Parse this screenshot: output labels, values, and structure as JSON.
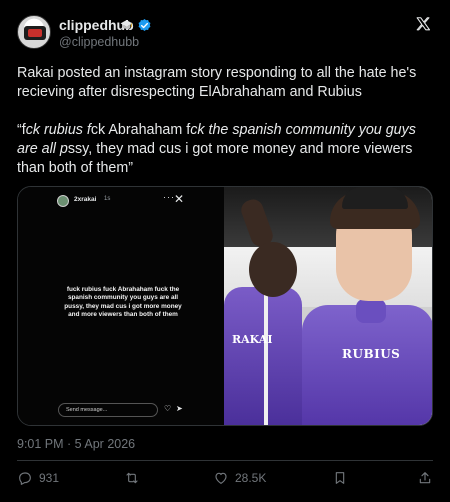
{
  "author": {
    "display_name": "clippedhub",
    "handle": "@clippedhubb",
    "avatar_icon": "avatar-logo",
    "badge_icons": [
      "graduation-cap-icon",
      "verified-badge-icon"
    ],
    "verified_color": "#1d9bf0"
  },
  "tweet": {
    "line1": "Rakai posted an instagram story responding to all the hate he's recieving after disrespecting ElAbrahaham and Rubius",
    "quote_open": "“f",
    "quote_a": "ck rubius f",
    "quote_b": "ck Abrahaham f",
    "quote_c_it": "ck the spanish community you guys are all p",
    "quote_d": "ssy, they mad cus i got more money and more viewers than both of them”"
  },
  "media": {
    "story": {
      "username": "2xrakai",
      "time": "1s",
      "caption": "fuck rubius fuck Abrahaham fuck the spanish community you guys are all pussy, they mad cus i got more money and more viewers than both of them",
      "message_placeholder": "Send message..."
    },
    "photo": {
      "left_jersey": "RAKAI",
      "right_jersey": "RUBIUS"
    }
  },
  "timestamp": "9:01 PM · 5 Apr 2026",
  "actions": {
    "replies": "931",
    "likes": "28.5K"
  },
  "colors": {
    "background": "#000000",
    "text": "#e7e9ea",
    "muted": "#71767b"
  }
}
